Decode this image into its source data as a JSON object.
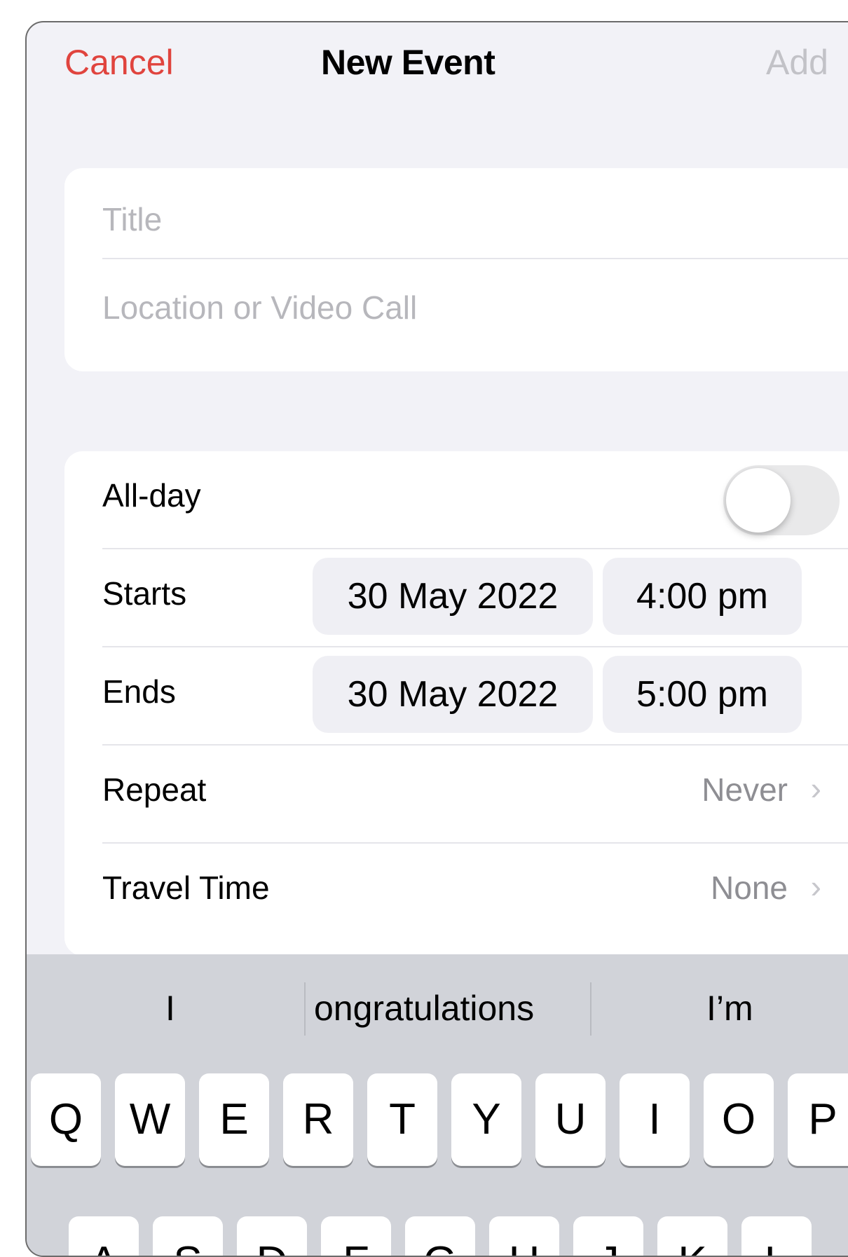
{
  "nav": {
    "cancel": "Cancel",
    "title": "New Event",
    "add": "Add"
  },
  "fields": {
    "title_placeholder": "Title",
    "location_placeholder": "Location or Video Call"
  },
  "rows": {
    "all_day": {
      "label": "All-day",
      "on": false
    },
    "starts": {
      "label": "Starts",
      "date": "30 May 2022",
      "time": "4:00 pm"
    },
    "ends": {
      "label": "Ends",
      "date": "30 May 2022",
      "time": "5:00 pm"
    },
    "repeat": {
      "label": "Repeat",
      "value": "Never"
    },
    "travel": {
      "label": "Travel Time",
      "value": "None"
    }
  },
  "keyboard": {
    "suggestions": [
      "I",
      "ongratulations",
      "I’m"
    ],
    "row1": [
      "Q",
      "W",
      "E",
      "R",
      "T",
      "Y",
      "U",
      "I",
      "O",
      "P"
    ],
    "row2": [
      "A",
      "S",
      "D",
      "F",
      "G",
      "H",
      "J",
      "K",
      "L"
    ]
  },
  "colors": {
    "accent": "#e0443e",
    "disabled": "#c2c2c7",
    "background": "#f2f2f7"
  },
  "icons": {
    "chevron": "chevron-right-icon"
  }
}
